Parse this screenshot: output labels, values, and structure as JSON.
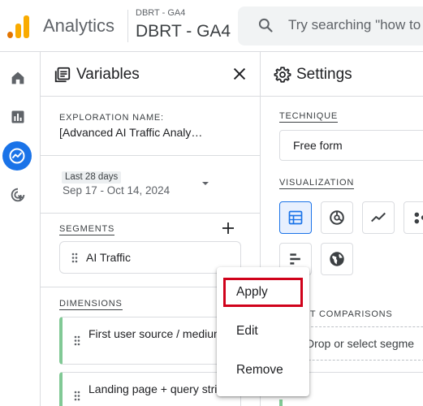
{
  "header": {
    "app_name": "Analytics",
    "property_account": "DBRT - GA4",
    "property_name": "DBRT - GA4",
    "search_placeholder": "Try searching \"how to",
    "logo_colors": [
      "#f9ab00",
      "#e37400"
    ]
  },
  "rail": {
    "items": [
      {
        "icon": "home-icon",
        "active": false
      },
      {
        "icon": "reports-icon",
        "active": false
      },
      {
        "icon": "explore-icon",
        "active": true
      },
      {
        "icon": "advertising-icon",
        "active": false
      }
    ]
  },
  "variables": {
    "title": "Variables",
    "exploration_label": "EXPLORATION NAME:",
    "exploration_name": "[Advanced AI Traffic Analy…",
    "date_chip": "Last 28 days",
    "date_range": "Sep 17 - Oct 14, 2024",
    "segments_label": "SEGMENTS",
    "segments": [
      {
        "label": "AI Traffic"
      }
    ],
    "dimensions_label": "DIMENSIONS",
    "dimensions": [
      {
        "label": "First user source / medium"
      },
      {
        "label": "Landing page + query string"
      }
    ]
  },
  "settings": {
    "title": "Settings",
    "technique_label": "TECHNIQUE",
    "technique_value": "Free form",
    "visualization_label": "VISUALIZATION",
    "visualizations": [
      "table-icon",
      "donut-icon",
      "line-chart-icon",
      "scatter-icon",
      "bar-chart-icon",
      "geo-map-icon"
    ],
    "segment_comparisons_label": "ENT COMPARISONS",
    "drop_text": "Drop or select segme"
  },
  "context_menu": {
    "items": [
      "Apply",
      "Edit",
      "Remove"
    ],
    "highlighted": "Apply",
    "highlight_color": "#d0021b"
  },
  "colors": {
    "accent": "#1a73e8",
    "dimension_chip_edge": "#81c995"
  }
}
